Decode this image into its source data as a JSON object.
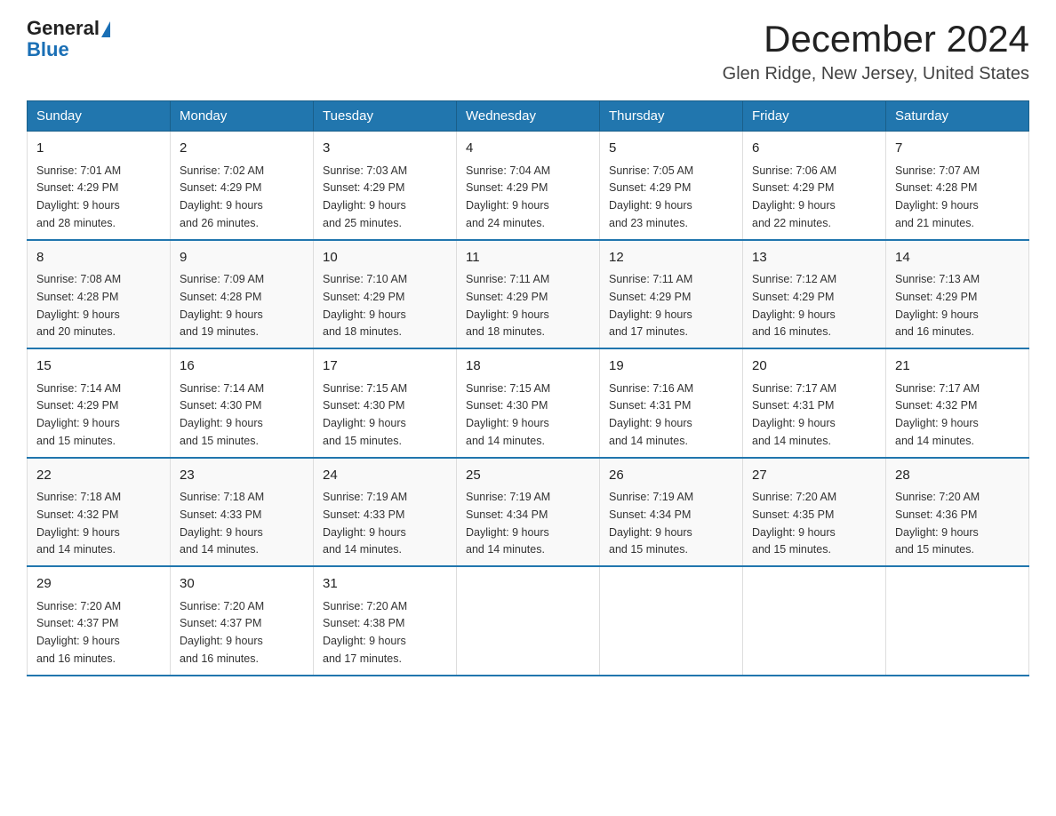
{
  "header": {
    "logo_general": "General",
    "logo_blue": "Blue",
    "title": "December 2024",
    "subtitle": "Glen Ridge, New Jersey, United States"
  },
  "days_of_week": [
    "Sunday",
    "Monday",
    "Tuesday",
    "Wednesday",
    "Thursday",
    "Friday",
    "Saturday"
  ],
  "weeks": [
    [
      {
        "num": "1",
        "sunrise": "7:01 AM",
        "sunset": "4:29 PM",
        "daylight": "9 hours and 28 minutes."
      },
      {
        "num": "2",
        "sunrise": "7:02 AM",
        "sunset": "4:29 PM",
        "daylight": "9 hours and 26 minutes."
      },
      {
        "num": "3",
        "sunrise": "7:03 AM",
        "sunset": "4:29 PM",
        "daylight": "9 hours and 25 minutes."
      },
      {
        "num": "4",
        "sunrise": "7:04 AM",
        "sunset": "4:29 PM",
        "daylight": "9 hours and 24 minutes."
      },
      {
        "num": "5",
        "sunrise": "7:05 AM",
        "sunset": "4:29 PM",
        "daylight": "9 hours and 23 minutes."
      },
      {
        "num": "6",
        "sunrise": "7:06 AM",
        "sunset": "4:29 PM",
        "daylight": "9 hours and 22 minutes."
      },
      {
        "num": "7",
        "sunrise": "7:07 AM",
        "sunset": "4:28 PM",
        "daylight": "9 hours and 21 minutes."
      }
    ],
    [
      {
        "num": "8",
        "sunrise": "7:08 AM",
        "sunset": "4:28 PM",
        "daylight": "9 hours and 20 minutes."
      },
      {
        "num": "9",
        "sunrise": "7:09 AM",
        "sunset": "4:28 PM",
        "daylight": "9 hours and 19 minutes."
      },
      {
        "num": "10",
        "sunrise": "7:10 AM",
        "sunset": "4:29 PM",
        "daylight": "9 hours and 18 minutes."
      },
      {
        "num": "11",
        "sunrise": "7:11 AM",
        "sunset": "4:29 PM",
        "daylight": "9 hours and 18 minutes."
      },
      {
        "num": "12",
        "sunrise": "7:11 AM",
        "sunset": "4:29 PM",
        "daylight": "9 hours and 17 minutes."
      },
      {
        "num": "13",
        "sunrise": "7:12 AM",
        "sunset": "4:29 PM",
        "daylight": "9 hours and 16 minutes."
      },
      {
        "num": "14",
        "sunrise": "7:13 AM",
        "sunset": "4:29 PM",
        "daylight": "9 hours and 16 minutes."
      }
    ],
    [
      {
        "num": "15",
        "sunrise": "7:14 AM",
        "sunset": "4:29 PM",
        "daylight": "9 hours and 15 minutes."
      },
      {
        "num": "16",
        "sunrise": "7:14 AM",
        "sunset": "4:30 PM",
        "daylight": "9 hours and 15 minutes."
      },
      {
        "num": "17",
        "sunrise": "7:15 AM",
        "sunset": "4:30 PM",
        "daylight": "9 hours and 15 minutes."
      },
      {
        "num": "18",
        "sunrise": "7:15 AM",
        "sunset": "4:30 PM",
        "daylight": "9 hours and 14 minutes."
      },
      {
        "num": "19",
        "sunrise": "7:16 AM",
        "sunset": "4:31 PM",
        "daylight": "9 hours and 14 minutes."
      },
      {
        "num": "20",
        "sunrise": "7:17 AM",
        "sunset": "4:31 PM",
        "daylight": "9 hours and 14 minutes."
      },
      {
        "num": "21",
        "sunrise": "7:17 AM",
        "sunset": "4:32 PM",
        "daylight": "9 hours and 14 minutes."
      }
    ],
    [
      {
        "num": "22",
        "sunrise": "7:18 AM",
        "sunset": "4:32 PM",
        "daylight": "9 hours and 14 minutes."
      },
      {
        "num": "23",
        "sunrise": "7:18 AM",
        "sunset": "4:33 PM",
        "daylight": "9 hours and 14 minutes."
      },
      {
        "num": "24",
        "sunrise": "7:19 AM",
        "sunset": "4:33 PM",
        "daylight": "9 hours and 14 minutes."
      },
      {
        "num": "25",
        "sunrise": "7:19 AM",
        "sunset": "4:34 PM",
        "daylight": "9 hours and 14 minutes."
      },
      {
        "num": "26",
        "sunrise": "7:19 AM",
        "sunset": "4:34 PM",
        "daylight": "9 hours and 15 minutes."
      },
      {
        "num": "27",
        "sunrise": "7:20 AM",
        "sunset": "4:35 PM",
        "daylight": "9 hours and 15 minutes."
      },
      {
        "num": "28",
        "sunrise": "7:20 AM",
        "sunset": "4:36 PM",
        "daylight": "9 hours and 15 minutes."
      }
    ],
    [
      {
        "num": "29",
        "sunrise": "7:20 AM",
        "sunset": "4:37 PM",
        "daylight": "9 hours and 16 minutes."
      },
      {
        "num": "30",
        "sunrise": "7:20 AM",
        "sunset": "4:37 PM",
        "daylight": "9 hours and 16 minutes."
      },
      {
        "num": "31",
        "sunrise": "7:20 AM",
        "sunset": "4:38 PM",
        "daylight": "9 hours and 17 minutes."
      },
      null,
      null,
      null,
      null
    ]
  ],
  "labels": {
    "sunrise": "Sunrise:",
    "sunset": "Sunset:",
    "daylight": "Daylight:"
  }
}
